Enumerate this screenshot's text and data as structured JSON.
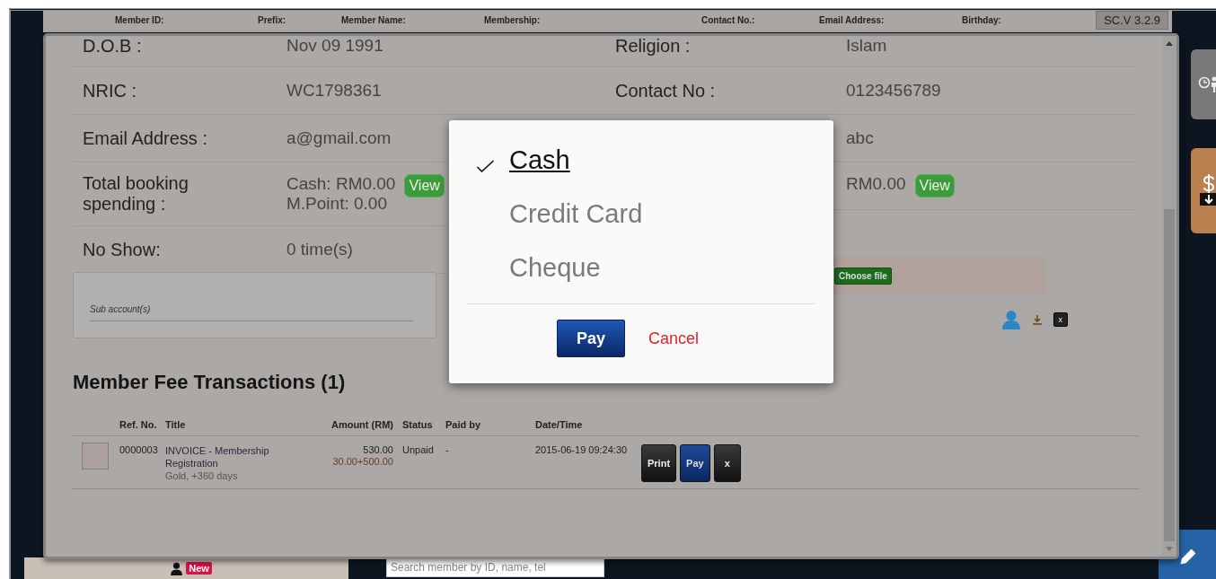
{
  "header": {
    "columns": [
      "Member ID:",
      "Prefix:",
      "Member Name:",
      "Membership:",
      "Contact No.:",
      "Email Address:",
      "Birthday:"
    ],
    "version": "SC.V 3.2.9"
  },
  "profile": {
    "left": [
      {
        "label": "D.O.B :",
        "values": [
          "Nov 09 1991"
        ]
      },
      {
        "label": "NRIC :",
        "values": [
          "WC1798361"
        ]
      },
      {
        "label": "Email Address :",
        "values": [
          "a@gmail.com"
        ]
      },
      {
        "label": "Total booking spending :",
        "values": [
          "Cash: RM0.00",
          "M.Point: 0.00"
        ],
        "button": "View"
      },
      {
        "label": "No Show:",
        "values": [
          "0 time(s)"
        ]
      }
    ],
    "right": [
      {
        "label": "Religion :",
        "values": [
          "Islam"
        ]
      },
      {
        "label": "Contact No :",
        "values": [
          "0123456789"
        ]
      },
      {
        "values": [
          "abc"
        ]
      },
      {
        "values": [
          "RM0.00"
        ],
        "button": "View"
      }
    ],
    "sub_account": "Sub account(s)",
    "files": {
      "choose_button": "Choose file",
      "delete_button": "x"
    }
  },
  "transactions": {
    "title": "Member Fee Transactions (1)",
    "columns": [
      "Ref. No.",
      "Title",
      "Amount (RM)",
      "Status",
      "Paid by",
      "Date/Time"
    ],
    "rows": [
      {
        "checked": false,
        "ref": "0000003",
        "title": "INVOICE - Membership Registration",
        "detail": "Gold, +360 days",
        "amount": "530.00",
        "amount_detail": "30.00+500.00",
        "status": "Unpaid",
        "paid_by": "-",
        "datetime": "2015-06-19 09:24:30",
        "actions": [
          {
            "kind": "print",
            "label": "Print"
          },
          {
            "kind": "pay",
            "label": "Pay"
          },
          {
            "kind": "delete",
            "label": "x"
          }
        ]
      }
    ]
  },
  "payment_popup": {
    "options": [
      {
        "label": "Cash",
        "selected": true
      },
      {
        "label": "Credit Card",
        "selected": false
      },
      {
        "label": "Cheque",
        "selected": false
      }
    ],
    "pay_button": "Pay",
    "cancel_button": "Cancel"
  },
  "bottom": {
    "badge": "New",
    "search": {
      "placeholder": "Search member by ID, name, tel"
    }
  }
}
